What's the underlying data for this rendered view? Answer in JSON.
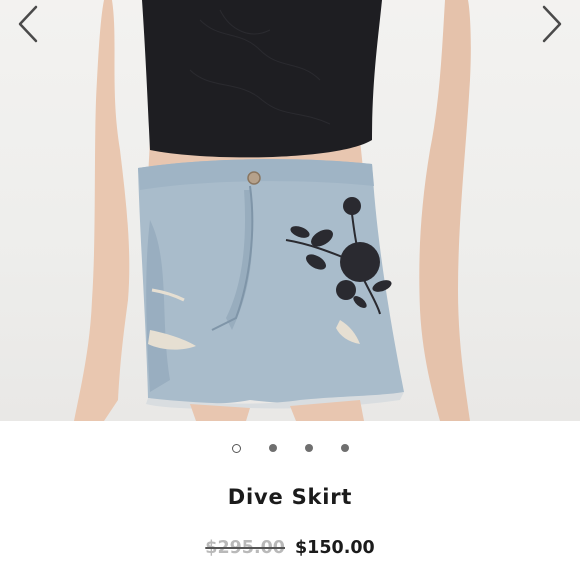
{
  "product": {
    "name": "Dive Skirt",
    "original_price": "$295.00",
    "sale_price": "$150.00"
  },
  "gallery": {
    "image_description_icon": "skirt-photo",
    "total_images": 4,
    "active_index": 0,
    "prev_icon": "chevron-left-icon",
    "next_icon": "chevron-right-icon"
  },
  "colors": {
    "background": "#ffffff",
    "title": "#1b1b1b",
    "old_price": "#b9b9b9",
    "dot": "#6f6f6f",
    "denim": "#a9bccb",
    "top": "#1e1e22"
  }
}
